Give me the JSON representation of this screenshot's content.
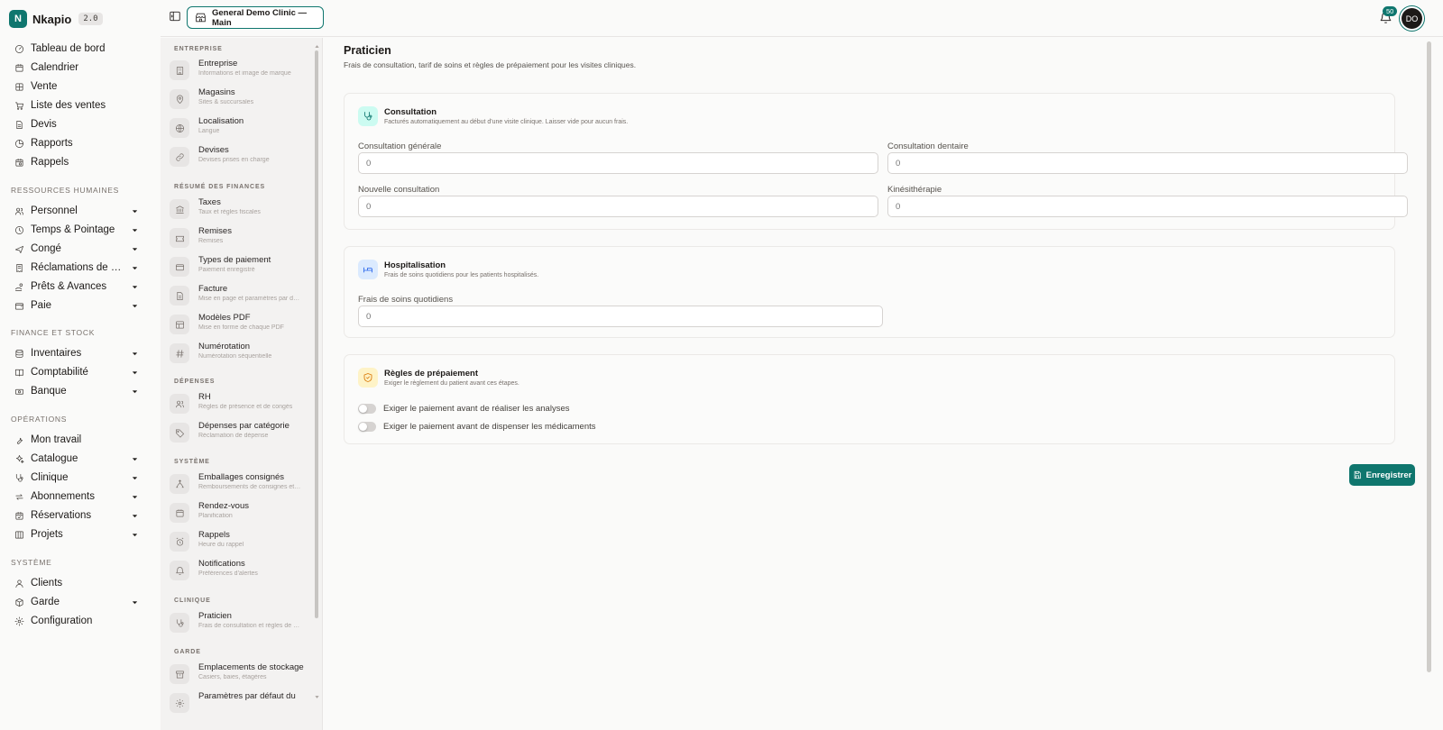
{
  "brand": {
    "name": "Nkapio",
    "version": "2.0",
    "logo_letter": "N"
  },
  "nav": {
    "items": [
      {
        "label": "Tableau de bord",
        "icon": "gauge-icon",
        "expandable": false
      },
      {
        "label": "Calendrier",
        "icon": "calendar-icon",
        "expandable": false
      },
      {
        "label": "Vente",
        "icon": "grid-icon",
        "expandable": false
      },
      {
        "label": "Liste des ventes",
        "icon": "cart-icon",
        "expandable": false
      },
      {
        "label": "Devis",
        "icon": "file-icon",
        "expandable": false
      },
      {
        "label": "Rapports",
        "icon": "pie-chart-icon",
        "expandable": false
      },
      {
        "label": "Rappels",
        "icon": "calendar-clock-icon",
        "expandable": false
      }
    ],
    "sections": [
      {
        "title": "RESSOURCES HUMAINES",
        "items": [
          {
            "label": "Personnel",
            "icon": "users-icon",
            "expandable": true
          },
          {
            "label": "Temps & Pointage",
            "icon": "clock-icon",
            "expandable": true
          },
          {
            "label": "Congé",
            "icon": "plane-icon",
            "expandable": true
          },
          {
            "label": "Réclamations de dépenses",
            "icon": "receipt-icon",
            "expandable": true
          },
          {
            "label": "Prêts & Avances",
            "icon": "hand-coins-icon",
            "expandable": true
          },
          {
            "label": "Paie",
            "icon": "wallet-icon",
            "expandable": true
          }
        ]
      },
      {
        "title": "FINANCE ET STOCK",
        "items": [
          {
            "label": "Inventaires",
            "icon": "database-icon",
            "expandable": true
          },
          {
            "label": "Comptabilité",
            "icon": "book-icon",
            "expandable": true
          },
          {
            "label": "Banque",
            "icon": "banknote-icon",
            "expandable": true
          }
        ]
      },
      {
        "title": "OPÉRATIONS",
        "items": [
          {
            "label": "Mon travail",
            "icon": "wrench-icon",
            "expandable": false
          },
          {
            "label": "Catalogue",
            "icon": "sparkles-icon",
            "expandable": true
          },
          {
            "label": "Clinique",
            "icon": "stethoscope-icon",
            "expandable": true
          },
          {
            "label": "Abonnements",
            "icon": "repeat-icon",
            "expandable": true
          },
          {
            "label": "Réservations",
            "icon": "calendar-check-icon",
            "expandable": true
          },
          {
            "label": "Projets",
            "icon": "kanban-icon",
            "expandable": true
          }
        ]
      },
      {
        "title": "SYSTÈME",
        "items": [
          {
            "label": "Clients",
            "icon": "user-icon",
            "expandable": false
          },
          {
            "label": "Garde",
            "icon": "box-icon",
            "expandable": true
          },
          {
            "label": "Configuration",
            "icon": "gear-icon",
            "expandable": false
          }
        ]
      }
    ]
  },
  "topbar": {
    "store_label": "General Demo Clinic — Main",
    "notifications_count": "50",
    "avatar_initials": "DO"
  },
  "settings": {
    "sections": [
      {
        "title": "ENTREPRISE",
        "items": [
          {
            "title": "Entreprise",
            "desc": "Informations et image de marque",
            "icon": "building-icon"
          },
          {
            "title": "Magasins",
            "desc": "Sites & succursales",
            "icon": "map-pin-icon"
          },
          {
            "title": "Localisation",
            "desc": "Langue",
            "icon": "globe-icon"
          },
          {
            "title": "Devises",
            "desc": "Devises prises en charge",
            "icon": "link-icon"
          }
        ]
      },
      {
        "title": "RÉSUMÉ DES FINANCES",
        "items": [
          {
            "title": "Taxes",
            "desc": "Taux et règles fiscales",
            "icon": "landmark-icon"
          },
          {
            "title": "Remises",
            "desc": "Remises",
            "icon": "ticket-icon"
          },
          {
            "title": "Types de paiement",
            "desc": "Paiement enregistré",
            "icon": "credit-card-icon"
          },
          {
            "title": "Facture",
            "desc": "Mise en page et paramètres par défaut",
            "icon": "file-text-icon"
          },
          {
            "title": "Modèles PDF",
            "desc": "Mise en forme de chaque PDF",
            "icon": "layout-icon"
          },
          {
            "title": "Numérotation",
            "desc": "Numérotation séquentielle",
            "icon": "hash-icon"
          }
        ]
      },
      {
        "title": "DÉPENSES",
        "items": [
          {
            "title": "RH",
            "desc": "Règles de présence et de congés",
            "icon": "users-icon"
          },
          {
            "title": "Dépenses par catégorie",
            "desc": "Réclamation de dépense",
            "icon": "tag-icon"
          }
        ]
      },
      {
        "title": "SYSTÈME",
        "items": [
          {
            "title": "Emballages consignés",
            "desc": "Remboursements de consignes et retours",
            "icon": "recycle-icon"
          },
          {
            "title": "Rendez-vous",
            "desc": "Planification",
            "icon": "calendar-icon"
          },
          {
            "title": "Rappels",
            "desc": "Heure du rappel",
            "icon": "alarm-icon"
          },
          {
            "title": "Notifications",
            "desc": "Préférences d'alertes",
            "icon": "bell-icon"
          }
        ]
      },
      {
        "title": "CLINIQUE",
        "items": [
          {
            "title": "Praticien",
            "desc": "Frais de consultation et règles de prépaiement",
            "icon": "stethoscope-icon"
          }
        ]
      },
      {
        "title": "GARDE",
        "items": [
          {
            "title": "Emplacements de stockage",
            "desc": "Casiers, baies, étagères",
            "icon": "archive-icon"
          },
          {
            "title": "Paramètres par défaut du",
            "desc": "",
            "icon": "gear-icon"
          }
        ]
      }
    ]
  },
  "page": {
    "title": "Praticien",
    "subtitle": "Frais de consultation, tarif de soins et règles de prépaiement pour les visites cliniques.",
    "consultation": {
      "title": "Consultation",
      "desc": "Facturés automatiquement au début d'une visite clinique. Laisser vide pour aucun frais.",
      "fields": [
        {
          "label": "Consultation générale",
          "placeholder": "0"
        },
        {
          "label": "Consultation dentaire",
          "placeholder": "0"
        },
        {
          "label": "Nouvelle consultation",
          "placeholder": "0"
        },
        {
          "label": "Kinésithérapie",
          "placeholder": "0"
        }
      ]
    },
    "hospitalisation": {
      "title": "Hospitalisation",
      "desc": "Frais de soins quotidiens pour les patients hospitalisés.",
      "field": {
        "label": "Frais de soins quotidiens",
        "placeholder": "0"
      }
    },
    "prepaiement": {
      "title": "Règles de prépaiement",
      "desc": "Exiger le règlement du patient avant ces étapes.",
      "toggles": [
        {
          "label": "Exiger le paiement avant de réaliser les analyses"
        },
        {
          "label": "Exiger le paiement avant de dispenser les médicaments"
        }
      ]
    },
    "save_label": "Enregistrer"
  },
  "colors": {
    "accent": "#0f766e",
    "amber": "#d97706",
    "blue": "#2563eb"
  }
}
